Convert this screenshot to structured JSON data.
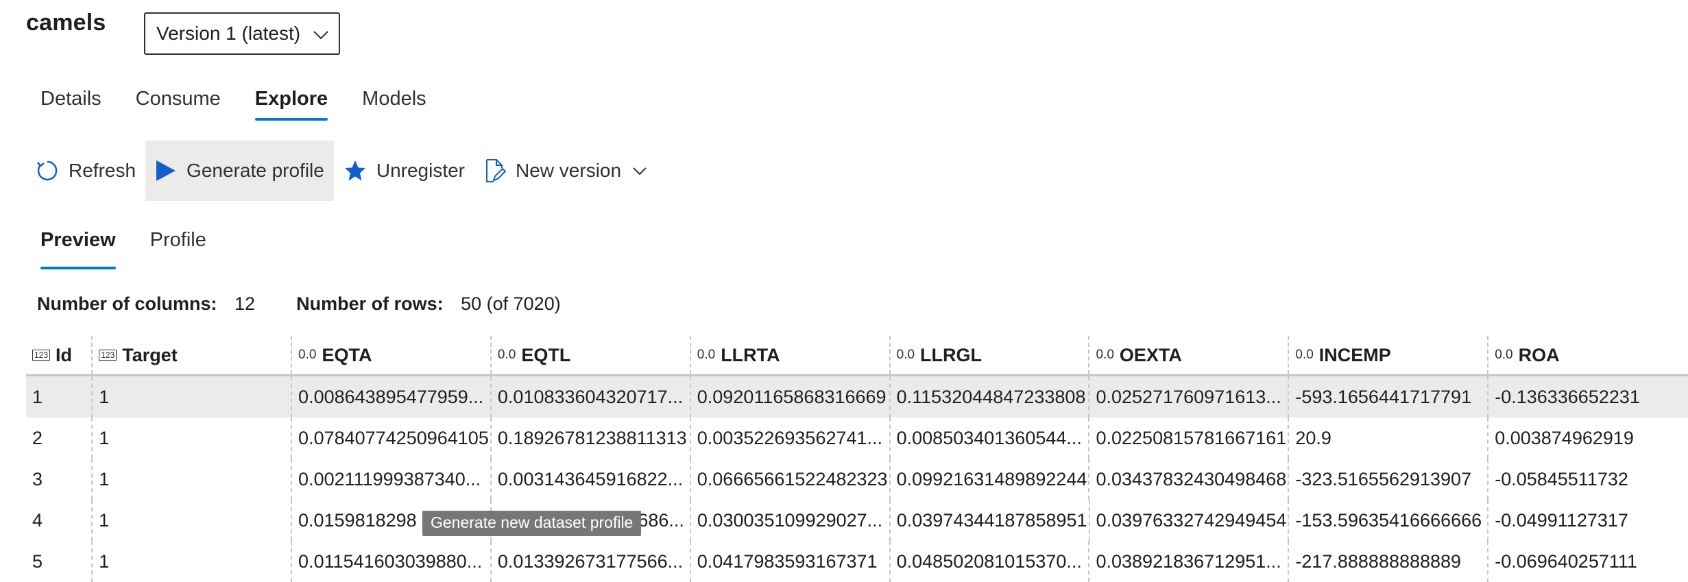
{
  "header": {
    "title": "camels",
    "version_selected": "Version 1 (latest)"
  },
  "tabs": [
    {
      "label": "Details"
    },
    {
      "label": "Consume"
    },
    {
      "label": "Explore",
      "active": true
    },
    {
      "label": "Models"
    }
  ],
  "toolbar": {
    "refresh": "Refresh",
    "generate_profile": "Generate profile",
    "unregister": "Unregister",
    "new_version": "New version"
  },
  "subtabs": [
    {
      "label": "Preview",
      "active": true
    },
    {
      "label": "Profile"
    }
  ],
  "stats": {
    "columns_label": "Number of columns:",
    "columns_value": "12",
    "rows_label": "Number of rows:",
    "rows_value": "50 (of 7020)"
  },
  "table": {
    "columns": [
      {
        "name": "Id",
        "type": "123"
      },
      {
        "name": "Target",
        "type": "123"
      },
      {
        "name": "EQTA",
        "type": "0.0"
      },
      {
        "name": "EQTL",
        "type": "0.0"
      },
      {
        "name": "LLRTA",
        "type": "0.0"
      },
      {
        "name": "LLRGL",
        "type": "0.0"
      },
      {
        "name": "OEXTA",
        "type": "0.0"
      },
      {
        "name": "INCEMP",
        "type": "0.0"
      },
      {
        "name": "ROA",
        "type": "0.0"
      }
    ],
    "rows": [
      [
        "1",
        "1",
        "0.008643895477959...",
        "0.010833604320717...",
        "0.09201165868316669",
        "0.11532044847233808",
        "0.025271760971613...",
        "-593.1656441717791",
        "-0.136336652231"
      ],
      [
        "2",
        "1",
        "0.07840774250964105",
        "0.18926781238811313",
        "0.003522693562741...",
        "0.008503401360544...",
        "0.02250815781667161",
        "20.9",
        "0.003874962919"
      ],
      [
        "3",
        "1",
        "0.002111999387340...",
        "0.003143645916822...",
        "0.06665661522482323",
        "0.09921631489892244",
        "0.03437832430498468",
        "-323.5165562913907",
        "-0.05845511732"
      ],
      [
        "4",
        "1",
        "0.0159818298",
        "686...",
        "0.030035109929027...",
        "0.03974344187858951",
        "0.03976332742949454",
        "-153.59635416666666",
        "-0.04991127317"
      ],
      [
        "5",
        "1",
        "0.011541603039880...",
        "0.013392673177566...",
        "0.0417983593167371",
        "0.048502081015370...",
        "0.038921836712951...",
        "-217.888888888889",
        "-0.069640257111"
      ]
    ]
  },
  "tooltip": "Generate new dataset profile",
  "colors": {
    "accent": "#0078d4",
    "icon_blue": "#0f5fcf",
    "selected_row": "#edebe9",
    "tooltip_bg": "#797775"
  }
}
